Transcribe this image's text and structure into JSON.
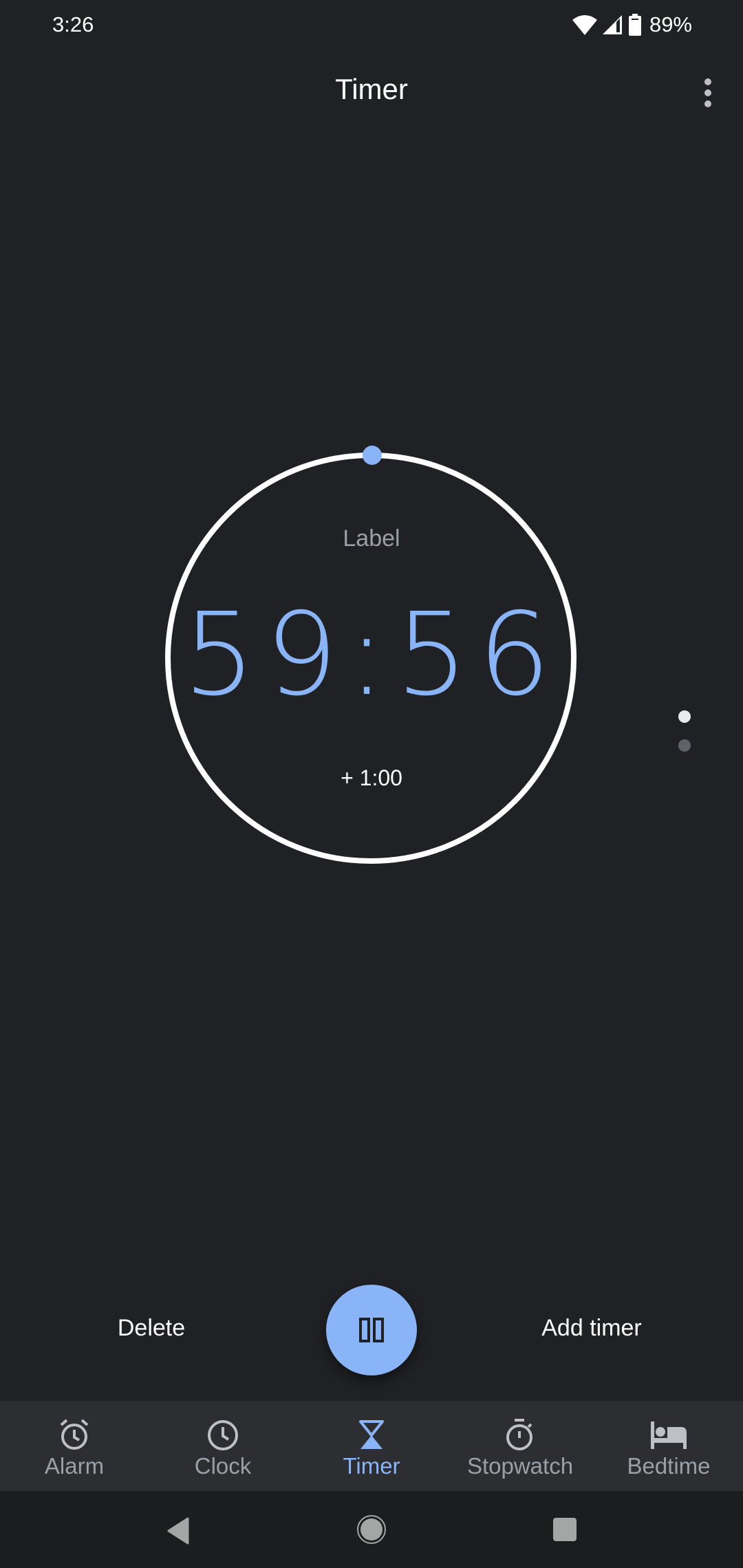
{
  "status_bar": {
    "time": "3:26",
    "battery_percent": "89%",
    "icons": [
      "wifi-icon",
      "cell-signal-icon",
      "battery-icon"
    ]
  },
  "app_bar": {
    "title": "Timer",
    "overflow_icon": "more-vert-icon"
  },
  "timer": {
    "label": "Label",
    "remaining": "59:56",
    "add_time": "+ 1:00",
    "progress_fraction": 0.999,
    "ring_color": "#ffffff",
    "accent_color": "#8ab4f8"
  },
  "pager": {
    "page_count": 2,
    "current_page": 1
  },
  "actions": {
    "delete_label": "Delete",
    "add_timer_label": "Add timer",
    "fab_icon": "pause-icon"
  },
  "tabs": [
    {
      "label": "Alarm",
      "icon": "alarm-icon",
      "active": false
    },
    {
      "label": "Clock",
      "icon": "clock-icon",
      "active": false
    },
    {
      "label": "Timer",
      "icon": "hourglass-icon",
      "active": true
    },
    {
      "label": "Stopwatch",
      "icon": "stopwatch-icon",
      "active": false
    },
    {
      "label": "Bedtime",
      "icon": "bed-icon",
      "active": false
    }
  ],
  "system_nav": {
    "icons": [
      "back-icon",
      "home-icon",
      "recents-icon"
    ]
  }
}
